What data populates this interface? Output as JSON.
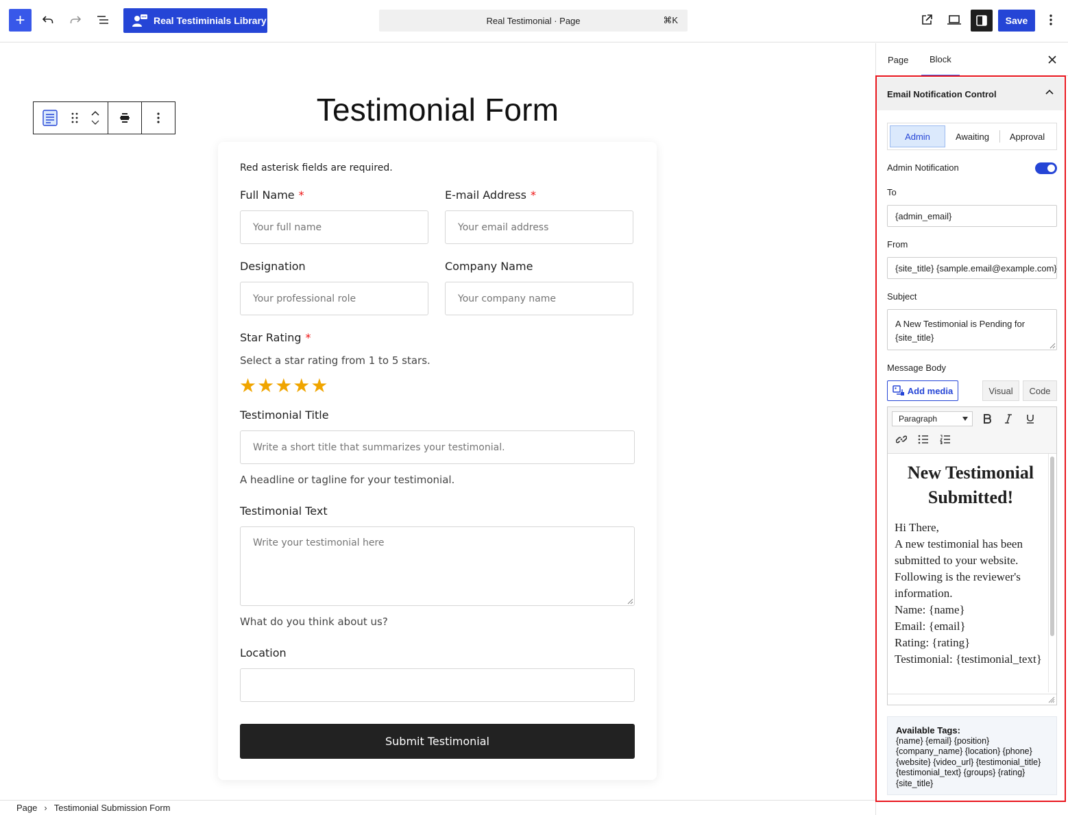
{
  "topbar": {
    "library_label": "Real Testiminials Library",
    "command_title": "Real Testimonial · Page",
    "command_shortcut": "⌘K",
    "save_label": "Save"
  },
  "form": {
    "title": "Testimonial Form",
    "required_note": "Red asterisk fields are required.",
    "full_name_label": "Full Name",
    "full_name_placeholder": "Your full name",
    "email_label": "E-mail Address",
    "email_placeholder": "Your email address",
    "designation_label": "Designation",
    "designation_placeholder": "Your professional role",
    "company_label": "Company Name",
    "company_placeholder": "Your company name",
    "rating_label": "Star Rating",
    "rating_help": "Select a star rating from 1 to 5 stars.",
    "rating_stars": "★★★★★",
    "rating_value": 5,
    "title_label": "Testimonial Title",
    "title_placeholder": "Write a short title that summarizes your testimonial.",
    "title_help": "A headline or tagline for your testimonial.",
    "text_label": "Testimonial Text",
    "text_placeholder": "Write your testimonial here",
    "text_help": "What do you think about us?",
    "location_label": "Location",
    "location_value": "",
    "required_mark": "*",
    "submit_label": "Submit Testimonial"
  },
  "footer": {
    "crumb_root": "Page",
    "crumb_separator": "›",
    "crumb_current": "Testimonial Submission Form"
  },
  "sidebar": {
    "tab_page": "Page",
    "tab_block": "Block",
    "panel_title": "Email Notification Control",
    "segments": [
      "Admin",
      "Awaiting",
      "Approval"
    ],
    "admin_notification_label": "Admin Notification",
    "admin_notification_on": true,
    "to_label": "To",
    "to_value": "{admin_email}",
    "from_label": "From",
    "from_value": "{site_title} {sample.email@example.com}",
    "subject_label": "Subject",
    "subject_value": "A New Testimonial is Pending for {site_title}",
    "message_label": "Message Body",
    "add_media_label": "Add media",
    "visual_label": "Visual",
    "code_label": "Code",
    "format_select": "Paragraph",
    "editor_heading": "New Testimonial Submitted!",
    "editor_lines": [
      "Hi There,",
      "A new testimonial has been submitted to your website. Following is the reviewer's information.",
      "Name: {name}",
      "Email: {email}",
      "Rating: {rating}",
      "Testimonial: {testimonial_text}"
    ],
    "tags_title": "Available Tags:",
    "tags_body": "{name} {email} {position} {company_name} {location} {phone} {website} {video_url} {testimonial_title} {testimonial_text} {groups} {rating} {site_title}"
  }
}
